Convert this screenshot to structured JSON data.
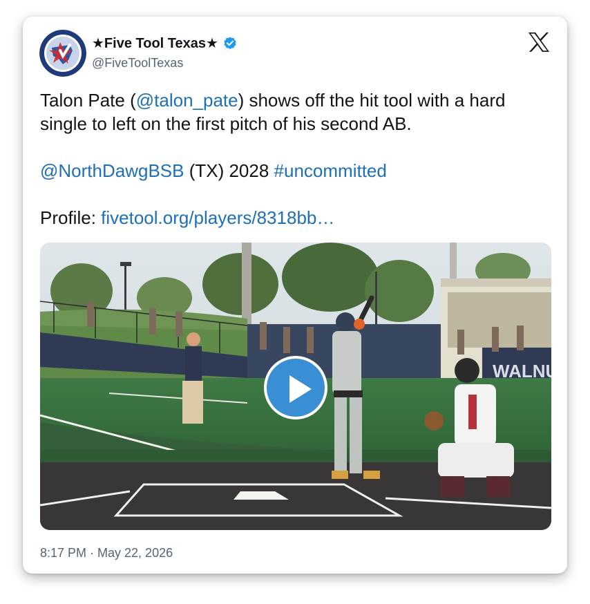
{
  "author": {
    "display_name": "★Five Tool Texas★",
    "handle": "@FiveToolTexas",
    "avatar_icon": "five-tool-texas-logo",
    "verified_icon": "verified-badge-icon",
    "verified_color": "#1d9bf0"
  },
  "platform_icon": "x-logo-icon",
  "tweet": {
    "line1_pre": "Talon Pate (",
    "mention_player": "@talon_pate",
    "line1_post": ") shows off the hit tool with a hard single to left on the first pitch of his second AB.",
    "mention_team": "@NorthDawgBSB",
    "team_mid": " (TX) 2028 ",
    "hashtag": "#uncommitted",
    "profile_label": "Profile: ",
    "profile_link": "fivetool.org/players/8318bb…"
  },
  "media": {
    "play_icon": "play-icon",
    "banner_text": "WALNU"
  },
  "timestamp": "8:17 PM · May 22, 2026",
  "colors": {
    "link": "#1d6fb8",
    "text": "#0f1419",
    "muted": "#536471",
    "play_button": "#3a8fd4"
  }
}
